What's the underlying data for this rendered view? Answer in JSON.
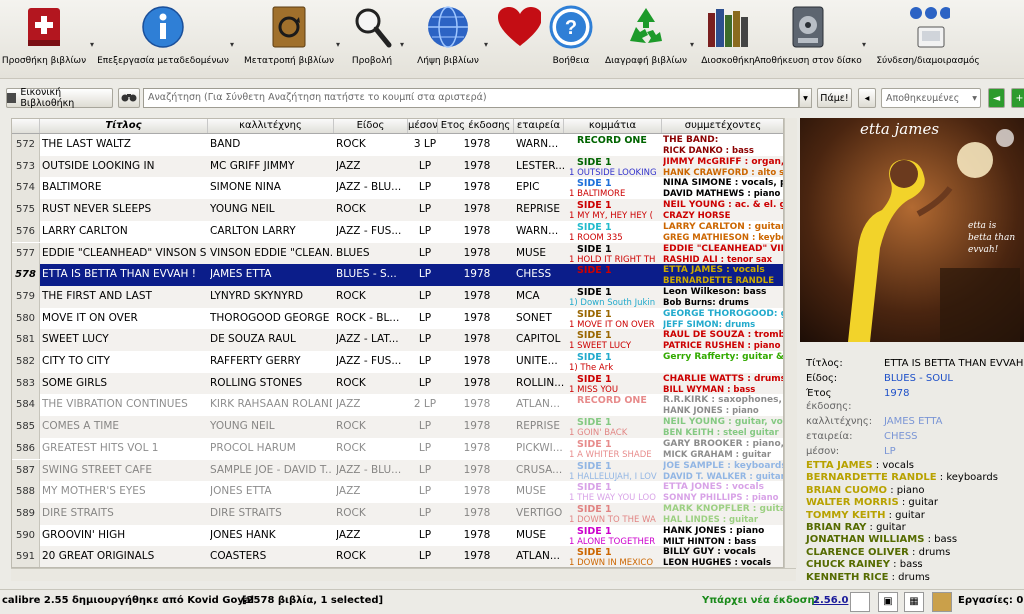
{
  "toolbar": {
    "add_books": "Προσθήκη βιβλίων",
    "edit_metadata": "Επεξεργασία μεταδεδομένων",
    "convert_books": "Μετατροπή βιβλίων",
    "view": "Προβολή",
    "get_books": "Λήψη βιβλίων",
    "help": "Βοήθεια",
    "remove_books": "Διαγραφή βιβλίων",
    "library": "Διοσκοθήκη",
    "save_to_disk": "Αποθήκευση στον δίσκο",
    "connect_share": "Σύνδεση/διαμοιρασμός"
  },
  "search": {
    "virtual_library_label": "Εικονική Βιβλιοθήκη",
    "placeholder": "Αναζήτηση (Για Σύνθετη Αναζήτηση πατήστε το κουμπί στα αριστερά)",
    "go_label": "Πάμε!",
    "saved_placeholder": "Αποθηκευμένες"
  },
  "columns": [
    "Τίτλος",
    "καλλιτέχνης",
    "Είδος",
    "μέσον",
    "Ετος έκδοσης",
    "εταιρεία",
    "κομμάτια",
    "συμμετέχοντες"
  ],
  "rows": [
    {
      "n": "572",
      "title": "THE LAST WALTZ",
      "artist": "BAND",
      "genre": "ROCK",
      "media": "3 LP",
      "year": "1978",
      "label": "WARN...",
      "h1": "RECORD ONE",
      "h1c": "#006400",
      "h2": "",
      "h2c": "#000",
      "p1": "THE BAND:",
      "p1c": "#8b0000",
      "p2": "RICK DANKO : bass",
      "p2c": "#8b0000"
    },
    {
      "n": "573",
      "title": "OUTSIDE LOOKING IN",
      "artist": "MC GRIFF JIMMY",
      "genre": "JAZZ",
      "media": "LP",
      "year": "1978",
      "label": "LESTER...",
      "h1": "SIDE 1",
      "h1c": "#006400",
      "h2": "1 OUTSIDE LOOKING",
      "h2c": "#3333cc",
      "p1": "JIMMY McGRIFF : organ, ke",
      "p1c": "#cc0000",
      "p2": "HANK CRAWFORD : alto sa",
      "p2c": "#cc6600"
    },
    {
      "n": "574",
      "title": "BALTIMORE",
      "artist": "SIMONE NINA",
      "genre": "JAZZ - BLU...",
      "media": "LP",
      "year": "1978",
      "label": "EPIC",
      "h1": "SIDE 1",
      "h1c": "#1e6fd9",
      "h2": "1 BALTIMORE",
      "h2c": "#cc0000",
      "p1": "NINA SIMONE : vocals, piano",
      "p1c": "#000",
      "p2": "DAVID MATHEWS : piano",
      "p2c": "#000"
    },
    {
      "n": "575",
      "title": "RUST NEVER SLEEPS",
      "artist": "YOUNG NEIL",
      "genre": "ROCK",
      "media": "LP",
      "year": "1978",
      "label": "REPRISE",
      "h1": "SIDE 1",
      "h1c": "#cc0000",
      "h2": "1 MY MY, HEY HEY (",
      "h2c": "#cc0000",
      "p1": "NEIL YOUNG : ac. & el. guita",
      "p1c": "#cc0000",
      "p2": "CRAZY HORSE",
      "p2c": "#cc0000"
    },
    {
      "n": "576",
      "title": "LARRY CARLTON",
      "artist": "CARLTON LARRY",
      "genre": "JAZZ - FUS...",
      "media": "LP",
      "year": "1978",
      "label": "WARN...",
      "h1": "SIDE 1",
      "h1c": "#22bbcc",
      "h2": "1 ROOM 335",
      "h2c": "#cc0000",
      "p1": "LARRY CARLTON : guitar &",
      "p1c": "#cc6600",
      "p2": "GREG MATHIESON : keyboa",
      "p2c": "#cc6600"
    },
    {
      "n": "577",
      "title": "EDDIE \"CLEANHEAD\" VINSON S...",
      "artist": "VINSON EDDIE \"CLEAN...",
      "genre": "BLUES",
      "media": "LP",
      "year": "1978",
      "label": "MUSE",
      "h1": "SIDE 1",
      "h1c": "#000",
      "h2": "1 HOLD IT RIGHT TH",
      "h2c": "#cc0000",
      "p1": "EDDIE \"CLEANHEAD\" VINS",
      "p1c": "#cc0000",
      "p2": "RASHID ALI : tenor sax",
      "p2c": "#cc0000"
    },
    {
      "n": "578",
      "title": "ETTA IS BETTA THAN EVVAH !",
      "artist": "JAMES ETTA",
      "genre": "BLUES - S...",
      "media": "LP",
      "year": "1978",
      "label": "CHESS",
      "h1": "SIDE 1",
      "h1c": "#cc0000",
      "h2": "",
      "h2c": "#cc0000",
      "p1": "ETTA JAMES : vocals",
      "p1c": "#ccaa00",
      "p2": "BERNARDETTE RANDLE",
      "p2c": "#ccaa00"
    },
    {
      "n": "579",
      "title": "THE FIRST AND LAST",
      "artist": "LYNYRD SKYNYRD",
      "genre": "ROCK",
      "media": "LP",
      "year": "1978",
      "label": "MCA",
      "h1": "SIDE 1",
      "h1c": "#000",
      "h2": "1) Down South Jukin",
      "h2c": "#22aacc",
      "p1": "Leon Wilkeson: bass",
      "p1c": "#000",
      "p2": "Bob Burns: drums",
      "p2c": "#000"
    },
    {
      "n": "580",
      "title": "MOVE IT ON OVER",
      "artist": "THOROGOOD GEORGE",
      "genre": "ROCK - BL...",
      "media": "LP",
      "year": "1978",
      "label": "SONET",
      "h1": "SIDE 1",
      "h1c": "#996600",
      "h2": "1 MOVE IT ON OVER",
      "h2c": "#cc0000",
      "p1": "GEORGE THOROGOOD: guita",
      "p1c": "#22aacc",
      "p2": "JEFF SIMON: drums",
      "p2c": "#22aacc"
    },
    {
      "n": "581",
      "title": "SWEET LUCY",
      "artist": "DE SOUZA RAUL",
      "genre": "JAZZ - LAT...",
      "media": "LP",
      "year": "1978",
      "label": "CAPITOL",
      "h1": "SIDE 1",
      "h1c": "#996600",
      "h2": "1 SWEET LUCY",
      "h2c": "#cc0000",
      "p1": "RAUL DE SOUZA : trombone",
      "p1c": "#cc0000",
      "p2": "PATRICE RUSHEN : piano",
      "p2c": "#cc0000"
    },
    {
      "n": "582",
      "title": "CITY TO CITY",
      "artist": "RAFFERTY GERRY",
      "genre": "JAZZ - FUS...",
      "media": "LP",
      "year": "1978",
      "label": "UNITE...",
      "h1": "SIDE 1",
      "h1c": "#22aacc",
      "h2": "1) The Ark",
      "h2c": "#cc0000",
      "p1": "Gerry Rafferty: guitar &",
      "p1c": "#33aa00",
      "p2": "",
      "p2c": "#000"
    },
    {
      "n": "583",
      "title": "SOME GIRLS",
      "artist": "ROLLING STONES",
      "genre": "ROCK",
      "media": "LP",
      "year": "1978",
      "label": "ROLLIN...",
      "h1": "SIDE 1",
      "h1c": "#cc0000",
      "h2": "1 MISS YOU",
      "h2c": "#cc0000",
      "p1": "CHARLIE WATTS : drums",
      "p1c": "#cc0000",
      "p2": "BILL WYMAN : bass",
      "p2c": "#cc0000"
    },
    {
      "n": "584",
      "title": "THE VIBRATION CONTINUES",
      "artist": "KIRK RAHSAAN ROLAND",
      "genre": "JAZZ",
      "media": "2 LP",
      "year": "1978",
      "label": "ATLAN...",
      "h1": "RECORD ONE",
      "h1c": "#cc0000",
      "h2": "",
      "h2c": "#000",
      "p1": "R.R.KIRK : saxophones, voc",
      "p1c": "#000",
      "p2": "HANK JONES : piano",
      "p2c": "#000"
    },
    {
      "n": "585",
      "title": "COMES A TIME",
      "artist": "YOUNG NEIL",
      "genre": "ROCK",
      "media": "LP",
      "year": "1978",
      "label": "REPRISE",
      "h1": "SIDE 1",
      "h1c": "#009900",
      "h2": "1 GOIN' BACK",
      "h2c": "#cc0000",
      "p1": "NEIL YOUNG : guitar, vocals",
      "p1c": "#009900",
      "p2": "BEN KEITH : steel guitar",
      "p2c": "#009900"
    },
    {
      "n": "586",
      "title": "GREATEST HITS VOL 1",
      "artist": "PROCOL HARUM",
      "genre": "ROCK",
      "media": "LP",
      "year": "1978",
      "label": "PICKWI...",
      "h1": "SIDE 1",
      "h1c": "#cc0000",
      "h2": "1 A WHITER SHADE",
      "h2c": "#cc0000",
      "p1": "GARY BROOKER : piano, voca",
      "p1c": "#000",
      "p2": "MICK GRAHAM : guitar",
      "p2c": "#000"
    },
    {
      "n": "587",
      "title": "SWING STREET CAFE",
      "artist": "SAMPLE JOE - DAVID T...",
      "genre": "JAZZ - BLU...",
      "media": "LP",
      "year": "1978",
      "label": "CRUSA...",
      "h1": "SIDE 1",
      "h1c": "#1e6fd9",
      "h2": "1 HALLELUJAH, I LOV",
      "h2c": "#1e6fd9",
      "p1": "JOE SAMPLE : keyboards",
      "p1c": "#1e6fd9",
      "p2": "DAVID T. WALKER : guitar",
      "p2c": "#1e6fd9"
    },
    {
      "n": "588",
      "title": "MY MOTHER'S EYES",
      "artist": "JONES ETTA",
      "genre": "JAZZ",
      "media": "LP",
      "year": "1978",
      "label": "MUSE",
      "h1": "SIDE 1",
      "h1c": "#aa33cc",
      "h2": "1 THE WAY YOU LOO",
      "h2c": "#aa33cc",
      "p1": "ETTA JONES : vocals",
      "p1c": "#aa33cc",
      "p2": "SONNY PHILLIPS : piano",
      "p2c": "#aa33cc"
    },
    {
      "n": "589",
      "title": "DIRE STRAITS",
      "artist": "DIRE STRAITS",
      "genre": "ROCK",
      "media": "LP",
      "year": "1978",
      "label": "VERTIGO",
      "h1": "SIDE 1",
      "h1c": "#cc0000",
      "h2": "1 DOWN TO THE WA",
      "h2c": "#cc0000",
      "p1": "MARK KNOPFLER : guitar",
      "p1c": "#33aa00",
      "p2": "HAL LINDES : guitar",
      "p2c": "#33aa00"
    },
    {
      "n": "590",
      "title": "GROOVIN' HIGH",
      "artist": "JONES HANK",
      "genre": "JAZZ",
      "media": "LP",
      "year": "1978",
      "label": "MUSE",
      "h1": "SIDE 1",
      "h1c": "#cc00cc",
      "h2": "1 ALONE TOGETHER",
      "h2c": "#cc00cc",
      "p1": "HANK JONES : piano",
      "p1c": "#000",
      "p2": "MILT HINTON : bass",
      "p2c": "#000"
    },
    {
      "n": "591",
      "title": "20 GREAT ORIGINALS",
      "artist": "COASTERS",
      "genre": "ROCK",
      "media": "LP",
      "year": "1978",
      "label": "ATLAN...",
      "h1": "SIDE 1",
      "h1c": "#cc6600",
      "h2": "1 DOWN IN MEXICO",
      "h2c": "#cc6600",
      "p1": "BILLY GUY : vocals",
      "p1c": "#000",
      "p2": "LEON HUGHES : vocals",
      "p2c": "#000"
    }
  ],
  "details": {
    "title_label": "Τίτλος:",
    "title_value": "ETTA IS BETTA THAN EVVAH !",
    "genre_label": "Είδος:",
    "genre_value": "BLUES - SOUL",
    "year_label": "Έτος",
    "year_value": "1978",
    "edition_label": "έκδοσης:",
    "artist_label": "καλλιτέχνης:",
    "artist_value": "JAMES ETTA",
    "label_label": "εταιρεία:",
    "label_value": "CHESS",
    "media_label": "μέσον:",
    "media_value": "LP",
    "performers": [
      {
        "name": "ETTA JAMES",
        "role": " : vocals",
        "color": "#b8a200"
      },
      {
        "name": "BERNARDETTE RANDLE",
        "role": " : keyboards",
        "color": "#b8a200"
      },
      {
        "name": "BRIAN CUOMO",
        "role": " : piano",
        "color": "#b8a200"
      },
      {
        "name": "WALTER MORRIS",
        "role": " : guitar",
        "color": "#b8a200"
      },
      {
        "name": "TOMMY KEITH",
        "role": " : guitar",
        "color": "#b8a200"
      },
      {
        "name": "BRIAN RAY",
        "role": " : guitar",
        "color": "#556b00"
      },
      {
        "name": "JONATHAN WILLIAMS",
        "role": " : bass",
        "color": "#556b00"
      },
      {
        "name": "CLARENCE OLIVER",
        "role": " : drums",
        "color": "#556b00"
      },
      {
        "name": "CHUCK RAINEY",
        "role": " : bass",
        "color": "#556b00"
      },
      {
        "name": "KENNETH RICE",
        "role": " : drums",
        "color": "#556b00"
      }
    ]
  },
  "cover": {
    "artist_text": "etta james",
    "title_text": "etta is betta than evvah!"
  },
  "status": {
    "left": "calibre 2.55 δημιουργήθηκε από Kovid Goyal",
    "count": "[2578 βιβλία, 1 selected]",
    "update_text": "Υπάρχει νέα έκδοση:",
    "update_version": "2.56.0",
    "jobs": "Εργασίες: 0"
  },
  "colors": {
    "selection": "#0b1d8a",
    "accent": "#1e50c8"
  }
}
